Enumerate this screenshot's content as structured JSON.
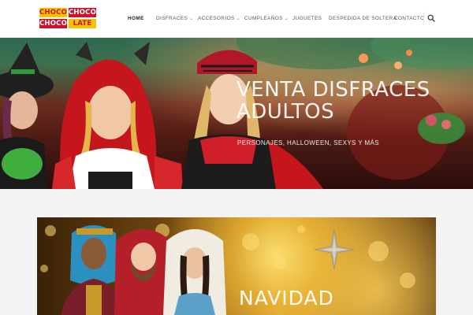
{
  "logo": {
    "lines": [
      "CHOCO",
      "CHOCO",
      "CHOCO",
      "LATE"
    ],
    "alt": "Choco Choco Late"
  },
  "nav": {
    "items": [
      {
        "label": "Home",
        "active": true,
        "dropdown": false
      },
      {
        "label": "Disfraces",
        "active": false,
        "dropdown": true
      },
      {
        "label": "Accesorios",
        "active": false,
        "dropdown": true
      },
      {
        "label": "Cumpleaños",
        "active": false,
        "dropdown": true
      },
      {
        "label": "Juguetes",
        "active": false,
        "dropdown": false
      },
      {
        "label": "Despedida de Soltera",
        "active": false,
        "dropdown": false
      },
      {
        "label": "Contacto",
        "active": false,
        "dropdown": false
      }
    ],
    "chevron": "chevron-down-icon",
    "search_icon": "search-icon"
  },
  "hero": {
    "title_line1": "Venta Disfraces",
    "title_line2": "Adultos",
    "subtitle": "Personajes, Halloween, Sexys y más"
  },
  "banner": {
    "title": "Navidad"
  },
  "colors": {
    "logo_yellow": "#f5c400",
    "logo_red": "#d0112b",
    "header_bg": "#ffffff",
    "page_bg": "#f3f3f3"
  }
}
